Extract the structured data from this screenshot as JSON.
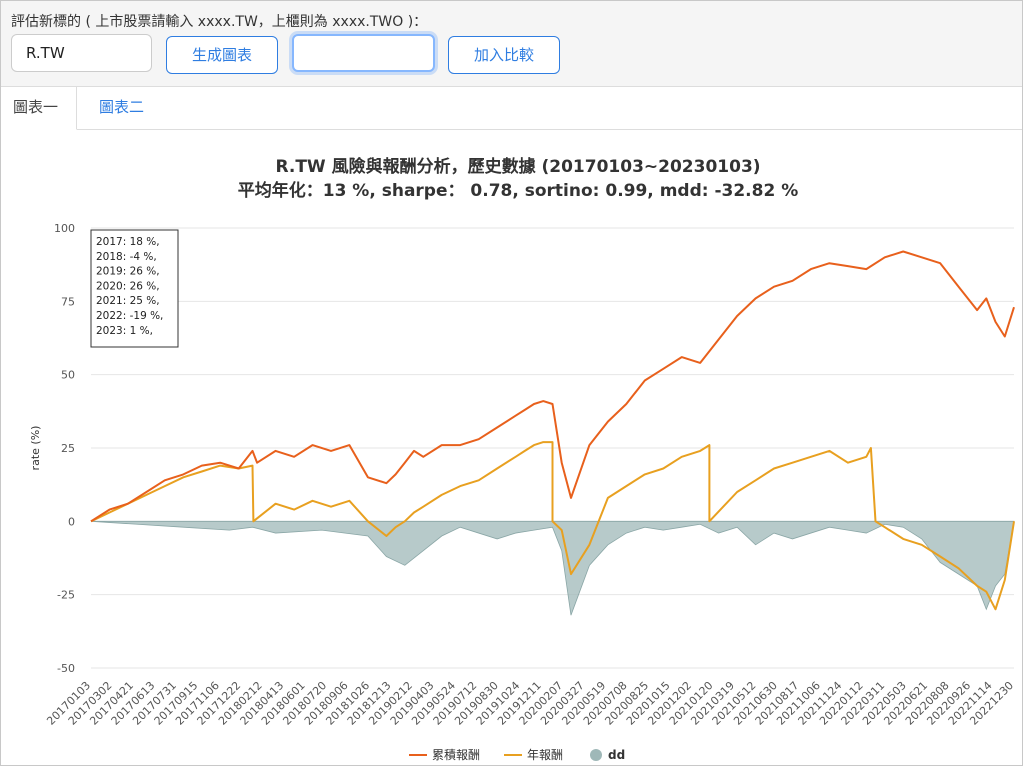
{
  "form": {
    "prompt": "評估新標的 ( 上市股票請輸入 xxxx.TW，上櫃則為 xxxx.TWO )：",
    "symbol_value": "R.TW",
    "generate_label": "生成圖表",
    "compare_value": "",
    "add_compare_label": "加入比較"
  },
  "tabs": [
    {
      "label": "圖表一",
      "active": true
    },
    {
      "label": "圖表二",
      "active": false
    }
  ],
  "chart_data": {
    "type": "line",
    "title": "R.TW 風險與報酬分析，歷史數據 (20170103~20230103)",
    "subtitle": "平均年化：13 %, sharpe：  0.78, sortino: 0.99, mdd: -32.82 %",
    "ylabel": "rate (%)",
    "ylim": [
      -50,
      100
    ],
    "yticks": [
      "100",
      "75",
      "50",
      "25",
      "0",
      "-25",
      "-50"
    ],
    "ytick_values": [
      100,
      75,
      50,
      25,
      0,
      -25,
      -50
    ],
    "grid": true,
    "legend_position": "bottom-center",
    "annual_box": [
      "2017: 18 %,",
      "2018: -4 %,",
      "2019: 26 %,",
      "2020: 26 %,",
      "2021: 25 %,",
      "2022: -19 %,",
      "2023: 1 %,"
    ],
    "x_tick_labels": [
      "20170103",
      "20170302",
      "20170421",
      "20170613",
      "20170731",
      "20170915",
      "20171106",
      "20171222",
      "20180212",
      "20180413",
      "20180601",
      "20180720",
      "20180906",
      "20181026",
      "20181213",
      "20190212",
      "20190403",
      "20190524",
      "20190712",
      "20190830",
      "20191024",
      "20191211",
      "20200207",
      "20200327",
      "20200519",
      "20200708",
      "20200825",
      "20201015",
      "20201202",
      "20210120",
      "20210319",
      "20210512",
      "20210630",
      "20210817",
      "20211006",
      "20211124",
      "20220112",
      "20220311",
      "20220503",
      "20220621",
      "20220808",
      "20220926",
      "20221114",
      "20221230"
    ],
    "series": [
      {
        "name": "累積報酬",
        "color": "#e8601c",
        "x": [
          0,
          0.02,
          0.04,
          0.06,
          0.08,
          0.1,
          0.12,
          0.14,
          0.16,
          0.175,
          0.18,
          0.2,
          0.22,
          0.24,
          0.26,
          0.28,
          0.3,
          0.32,
          0.33,
          0.34,
          0.35,
          0.36,
          0.38,
          0.4,
          0.42,
          0.44,
          0.46,
          0.47,
          0.48,
          0.49,
          0.5,
          0.51,
          0.52,
          0.54,
          0.56,
          0.58,
          0.6,
          0.62,
          0.64,
          0.66,
          0.68,
          0.7,
          0.72,
          0.74,
          0.76,
          0.78,
          0.8,
          0.82,
          0.84,
          0.86,
          0.87,
          0.88,
          0.9,
          0.92,
          0.94,
          0.96,
          0.97,
          0.98,
          0.99,
          1.0
        ],
        "values": [
          0,
          4,
          6,
          10,
          14,
          16,
          19,
          20,
          18,
          24,
          20,
          24,
          22,
          26,
          24,
          26,
          15,
          13,
          16,
          20,
          24,
          22,
          26,
          26,
          28,
          32,
          36,
          38,
          40,
          41,
          40,
          20,
          8,
          26,
          34,
          40,
          48,
          52,
          56,
          54,
          62,
          70,
          76,
          80,
          82,
          86,
          88,
          87,
          86,
          90,
          91,
          92,
          90,
          88,
          80,
          72,
          76,
          68,
          63,
          73
        ]
      },
      {
        "name": "年報酬",
        "color": "#e8a020",
        "x": [
          0,
          0.02,
          0.04,
          0.06,
          0.08,
          0.1,
          0.12,
          0.14,
          0.16,
          0.175,
          0.176,
          0.2,
          0.22,
          0.24,
          0.26,
          0.28,
          0.3,
          0.32,
          0.33,
          0.34,
          0.35,
          0.36,
          0.38,
          0.4,
          0.42,
          0.44,
          0.46,
          0.47,
          0.48,
          0.49,
          0.5,
          0.5,
          0.51,
          0.52,
          0.54,
          0.56,
          0.58,
          0.6,
          0.62,
          0.64,
          0.66,
          0.67,
          0.67,
          0.7,
          0.72,
          0.74,
          0.76,
          0.78,
          0.8,
          0.82,
          0.84,
          0.845,
          0.85,
          0.86,
          0.88,
          0.9,
          0.92,
          0.94,
          0.96,
          0.97,
          0.98,
          0.99,
          1.0
        ],
        "values": [
          0,
          3,
          6,
          9,
          12,
          15,
          17,
          19,
          18,
          19,
          0,
          6,
          4,
          7,
          5,
          7,
          0,
          -5,
          -2,
          0,
          3,
          5,
          9,
          12,
          14,
          18,
          22,
          24,
          26,
          27,
          27,
          0,
          -3,
          -18,
          -8,
          8,
          12,
          16,
          18,
          22,
          24,
          26,
          0,
          10,
          14,
          18,
          20,
          22,
          24,
          20,
          22,
          25,
          0,
          -2,
          -6,
          -8,
          -12,
          -16,
          -22,
          -24,
          -30,
          -20,
          0
        ]
      },
      {
        "name": "dd",
        "color": "#9fb8b8",
        "x": [
          0,
          0.05,
          0.1,
          0.15,
          0.175,
          0.2,
          0.25,
          0.3,
          0.32,
          0.34,
          0.36,
          0.38,
          0.4,
          0.42,
          0.44,
          0.46,
          0.48,
          0.5,
          0.51,
          0.52,
          0.54,
          0.56,
          0.58,
          0.6,
          0.62,
          0.64,
          0.66,
          0.68,
          0.7,
          0.72,
          0.74,
          0.76,
          0.78,
          0.8,
          0.82,
          0.84,
          0.86,
          0.88,
          0.9,
          0.92,
          0.94,
          0.96,
          0.97,
          0.98,
          0.99,
          1.0
        ],
        "values": [
          0,
          -1,
          -2,
          -3,
          -2,
          -4,
          -3,
          -5,
          -12,
          -15,
          -10,
          -5,
          -2,
          -4,
          -6,
          -4,
          -3,
          -2,
          -10,
          -32,
          -15,
          -8,
          -4,
          -2,
          -3,
          -2,
          -1,
          -4,
          -2,
          -8,
          -4,
          -6,
          -4,
          -2,
          -3,
          -4,
          -1,
          -2,
          -6,
          -14,
          -18,
          -22,
          -30,
          -22,
          -18,
          0
        ]
      }
    ]
  }
}
